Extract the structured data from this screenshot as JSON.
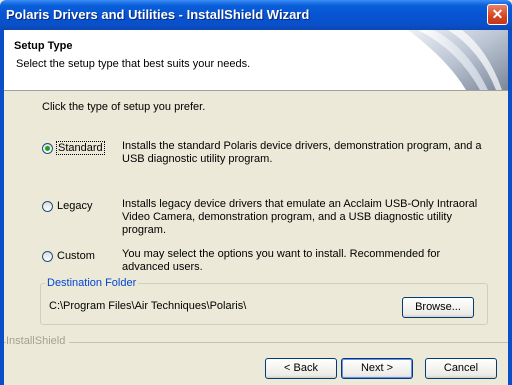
{
  "window": {
    "title": "Polaris Drivers and Utilities - InstallShield Wizard",
    "close_icon": "close-icon"
  },
  "header": {
    "title": "Setup Type",
    "subtitle": "Select the setup type that best suits your needs."
  },
  "prompt": "Click the type of setup you prefer.",
  "options": [
    {
      "label": "Standard",
      "selected": true,
      "description": "Installs the standard Polaris device drivers, demonstration program, and a USB diagnostic utility program."
    },
    {
      "label": "Legacy",
      "selected": false,
      "description": "Installs legacy device drivers that emulate an Acclaim USB-Only Intraoral Video Camera, demonstration program, and a USB diagnostic utility program."
    },
    {
      "label": "Custom",
      "selected": false,
      "description": "You may select the options you want to install. Recommended for advanced users."
    }
  ],
  "destination": {
    "legend": "Destination Folder",
    "path": "C:\\Program Files\\Air Techniques\\Polaris\\",
    "browse_label": "Browse..."
  },
  "brand": "InstallShield",
  "buttons": {
    "back_label": "< Back",
    "next_label": "Next >",
    "cancel_label": "Cancel"
  }
}
